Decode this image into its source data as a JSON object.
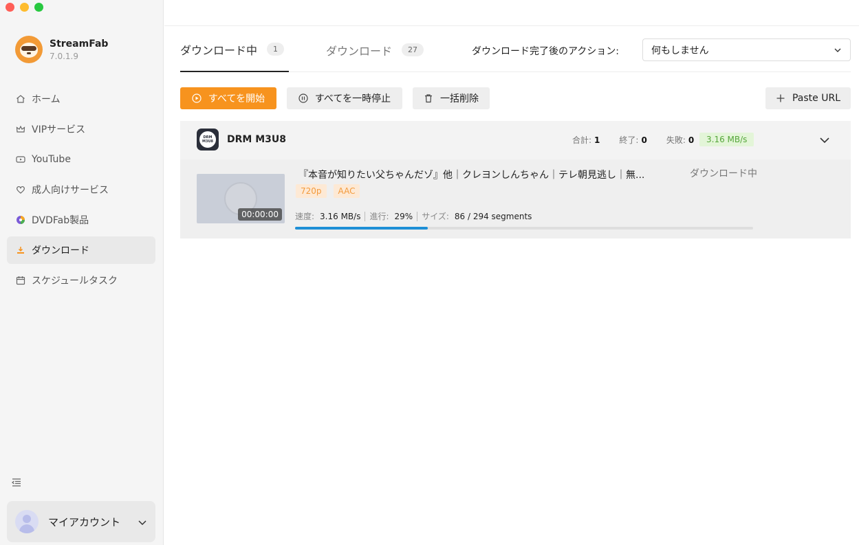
{
  "window": {
    "traffic_colors": [
      "#ff5f57",
      "#febc2e",
      "#28c840"
    ]
  },
  "brand": {
    "name": "StreamFab",
    "version": "7.0.1.9"
  },
  "sidebar": {
    "items": [
      {
        "label": "ホーム",
        "icon": "home-icon"
      },
      {
        "label": "VIPサービス",
        "icon": "crown-icon"
      },
      {
        "label": "YouTube",
        "icon": "youtube-icon"
      },
      {
        "label": "成人向けサービス",
        "icon": "heart-icon"
      },
      {
        "label": "DVDFab製品",
        "icon": "dvdfab-icon"
      },
      {
        "label": "ダウンロード",
        "icon": "download-icon",
        "active": true
      },
      {
        "label": "スケジュールタスク",
        "icon": "calendar-icon"
      }
    ],
    "account_label": "マイアカウント"
  },
  "tabs": [
    {
      "label": "ダウンロード中",
      "count": "1",
      "active": true
    },
    {
      "label": "ダウンロード",
      "count": "27",
      "active": false
    }
  ],
  "after_action": {
    "label": "ダウンロード完了後のアクション:",
    "selected": "何もしません"
  },
  "toolbar": {
    "start_all": "すべてを開始",
    "pause_all": "すべてを一時停止",
    "delete_all": "一括削除",
    "paste_url": "Paste URL"
  },
  "group": {
    "title": "DRM M3U8",
    "icon_text_top": "DRM",
    "icon_text_bottom": "M3U8",
    "total_label": "合計:",
    "total_value": "1",
    "done_label": "終了:",
    "done_value": "0",
    "failed_label": "失敗:",
    "failed_value": "0",
    "speed": "3.16 MB/s"
  },
  "item": {
    "title": "『本音が知りたい父ちゃんだゾ』他｜クレヨンしんちゃん｜テレ朝見逃し｜無...",
    "status": "ダウンロード中",
    "duration": "00:00:00",
    "tags": [
      "720p",
      "AAC"
    ],
    "speed_label": "速度:",
    "speed_value": "3.16 MB/s",
    "progress_label": "進行:",
    "progress_value": "29%",
    "progress_fraction": 0.29,
    "size_label": "サイズ:",
    "size_value": "86 / 294 segments"
  },
  "colors": {
    "accent": "#f7931e",
    "progress": "#1e8fd6",
    "speed_badge_bg": "#e3f5d8",
    "speed_badge_text": "#55a63a"
  }
}
